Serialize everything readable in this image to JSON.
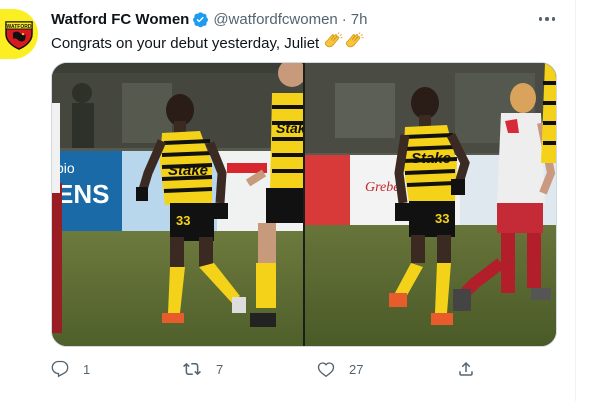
{
  "tweet": {
    "author_name": "Watford FC Women",
    "handle": "@watfordfcwomen",
    "separator": "·",
    "time": "7h",
    "text": "Congrats on your debut yesterday, Juliet",
    "emoji": [
      "clapping-hands",
      "clapping-hands"
    ],
    "verified": true
  },
  "avatar": {
    "logo_text": "WATFORD",
    "colors": {
      "yellow": "#fbee23",
      "red": "#d71920",
      "black": "#111111"
    }
  },
  "photos": {
    "left": {
      "shirt_number": "33",
      "sponsor": "Stake"
    },
    "right": {
      "shirt_number": "33",
      "sponsor": "Stake"
    },
    "ad_boards": [
      "pio",
      "ENS",
      "Grebe"
    ]
  },
  "actions": {
    "reply": {
      "icon": "reply-icon",
      "count": "1"
    },
    "retweet": {
      "icon": "retweet-icon",
      "count": "7"
    },
    "like": {
      "icon": "heart-icon",
      "count": "27"
    },
    "share": {
      "icon": "share-icon"
    }
  },
  "colors": {
    "text_primary": "#0f1419",
    "text_secondary": "#536471",
    "verified_blue": "#1d9bf0",
    "border": "#cfd9de"
  }
}
